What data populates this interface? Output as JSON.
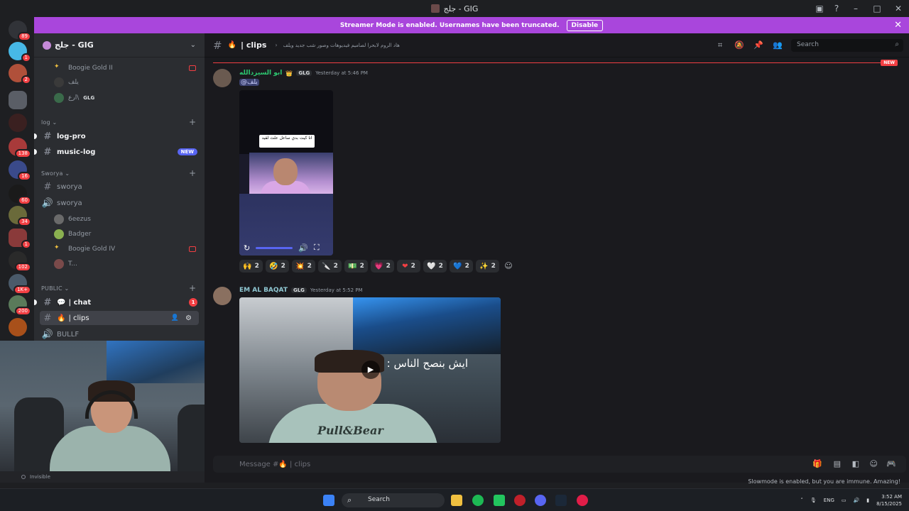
{
  "window": {
    "title": "جلج - GIG"
  },
  "banner": {
    "text": "Streamer Mode is enabled. Usernames have been truncated.",
    "button": "Disable"
  },
  "rail": {
    "badges": [
      "89",
      "1",
      "2",
      "138",
      "16",
      "60",
      "34",
      "1",
      "102",
      "1K+",
      "200"
    ]
  },
  "guild": {
    "name": "جلج - GIG"
  },
  "sidebar": {
    "top_users": [
      "Boogie Gold II",
      "يلف",
      "ارع\\",
      "GLG"
    ],
    "cat_log": "log",
    "log_pro": "log-pro",
    "music_log": "music-log",
    "new_pill": "NEW",
    "cat_sworya": "Sworya",
    "sworya_text": "sworya",
    "sworya_voice": "sworya",
    "voice_users": [
      "6eezus",
      "Badger",
      "Boogie Gold IV",
      "T..."
    ],
    "cat_public": "PUBLIC",
    "chat": "| chat",
    "chat_badge": "1",
    "clips": "| clips",
    "bullf": "BULLF"
  },
  "userpanel": {
    "status": "Invisible"
  },
  "channel": {
    "name": "| clips",
    "topic": "هاد الروم لابحرا لصاميم فيديوهات وصور شب جديد ويلف",
    "search_placeholder": "Search"
  },
  "new_tag": "NEW",
  "messages": [
    {
      "username": "ابو السيزدالله",
      "tag": "GLG",
      "time": "Yesterday at 5:46 PM",
      "mention": "@يلف",
      "video_caption": "انا كيت بدي ساعل علث لقيد",
      "reactions": [
        {
          "emoji": "🙌",
          "count": "2"
        },
        {
          "emoji": "🤣",
          "count": "2"
        },
        {
          "emoji": "💥",
          "count": "2"
        },
        {
          "emoji": "🔪",
          "count": "2"
        },
        {
          "emoji": "💵",
          "count": "2"
        },
        {
          "emoji": "💗",
          "count": "2"
        },
        {
          "emoji": "❤",
          "count": "2"
        },
        {
          "emoji": "🤍",
          "count": "2"
        },
        {
          "emoji": "💙",
          "count": "2"
        },
        {
          "emoji": "✨",
          "count": "2"
        }
      ]
    },
    {
      "username": "EM AL BAQAT",
      "tag": "GLG",
      "time": "Yesterday at 5:52 PM",
      "video_text": "ايش بنصح الناس :",
      "shirt_text": "Pull&Bear"
    }
  ],
  "composer": {
    "placeholder": "Message #🔥 | clips"
  },
  "slowmode": "Slowmode is enabled, but you are immune. Amazing!",
  "taskbar": {
    "search": "Search",
    "lang": "ENG",
    "time": "3:52 AM",
    "date": "8/15/2025"
  }
}
